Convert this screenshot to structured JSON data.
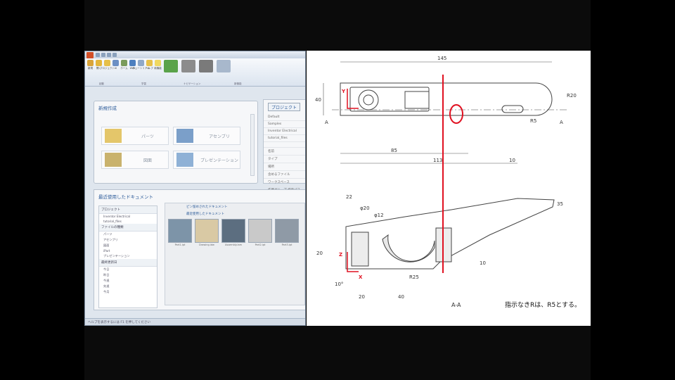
{
  "app": {
    "title": "",
    "status_text": "ヘルプを表示するには F1 を押してください"
  },
  "ribbon": {
    "buttons": [
      {
        "icon": "new-icon",
        "label": "新規",
        "color": "#d9a43a"
      },
      {
        "icon": "open-icon",
        "label": "開く",
        "color": "#e3b63c"
      },
      {
        "icon": "project-icon",
        "label": "プロジェクト",
        "color": "#e6c04a"
      },
      {
        "icon": "ui-icon",
        "label": "UI",
        "color": "#6b8fc4"
      },
      {
        "icon": "home-icon",
        "label": "ホーム",
        "color": "#7a9b5c"
      },
      {
        "icon": "web-icon",
        "label": "Web",
        "color": "#4d7fbf"
      },
      {
        "icon": "tutorial-icon",
        "label": "チュートリアル",
        "color": "#8fa8c8"
      },
      {
        "icon": "help-icon",
        "label": "ヘルプ",
        "color": "#e6c04a"
      },
      {
        "icon": "bulb-icon",
        "label": "新機能",
        "color": "#f0d860"
      },
      {
        "icon": "model-icon",
        "label": "",
        "color": "#5aa34a"
      },
      {
        "icon": "feature-icon",
        "label": "",
        "color": "#8c8c8c"
      },
      {
        "icon": "video-icon",
        "label": "",
        "color": "#7a7a7a"
      },
      {
        "icon": "learn-icon",
        "label": "",
        "color": "#a8b8cc"
      }
    ],
    "groups": [
      "起動",
      "学習",
      "ナビゲーション",
      "新機能"
    ]
  },
  "new_panel": {
    "heading": "新規作成",
    "tiles": [
      {
        "label": "パーツ",
        "color": "#e4c66a"
      },
      {
        "label": "アセンブリ",
        "color": "#7b9fc9"
      },
      {
        "label": "図面",
        "color": "#c9b26d"
      },
      {
        "label": "プレゼンテーション",
        "color": "#8fb1d6"
      }
    ]
  },
  "project_panel": {
    "button": "プロジェクト",
    "rows": [
      "Default",
      "Samples",
      "Inventor Electrical",
      "tutorial_files",
      "",
      "名前",
      "タイプ",
      "場所",
      "含めるファイル",
      "ワークスペース",
      "作業グループ 検索パス"
    ]
  },
  "recent_panel": {
    "heading": "最近使用したドキュメント",
    "tree": [
      {
        "group": "プロジェクト",
        "items": [
          "Inventor Electrical",
          "tutorial_files"
        ]
      },
      {
        "group": "ファイルの種類",
        "items": [
          "パーツ",
          "アセンブリ",
          "図面",
          "iPart",
          "プレゼンテーション"
        ]
      },
      {
        "group": "最終更新日",
        "items": [
          "今日",
          "昨日",
          "今週",
          "先週",
          "今月"
        ]
      }
    ],
    "thumb_titles": [
      "ピン留めされたドキュメント",
      "最近使用したドキュメント"
    ],
    "thumbs": [
      {
        "label": "Part1.ipt",
        "color": "#7d94a8"
      },
      {
        "label": "Drawing.idw",
        "color": "#d9c9a4"
      },
      {
        "label": "Assembly.iam",
        "color": "#5c6e80"
      },
      {
        "label": "Part2.ipt",
        "color": "#c9c9c9"
      },
      {
        "label": "Part3.ipt",
        "color": "#8f9aa6"
      }
    ]
  },
  "drawing": {
    "dims_top": {
      "overall_length": "145",
      "height": "40",
      "radius_right": "R20",
      "length_85": "85",
      "length_113": "113",
      "length_10": "10",
      "radius_5": "R5"
    },
    "dims_bottom": {
      "d22": "22",
      "d_phi20": "φ20",
      "d_phi12": "φ12",
      "d20a": "20",
      "d20b": "20",
      "d40": "40",
      "d10": "10",
      "d35": "35",
      "angle": "10°",
      "r25": "R25"
    },
    "section_marker": "A",
    "section_label": "A-A",
    "note": "指示なきRは、R5とする。",
    "annotation_color": "#e01020",
    "axis_x": "X",
    "axis_y": "Y",
    "axis_z": "Z"
  }
}
